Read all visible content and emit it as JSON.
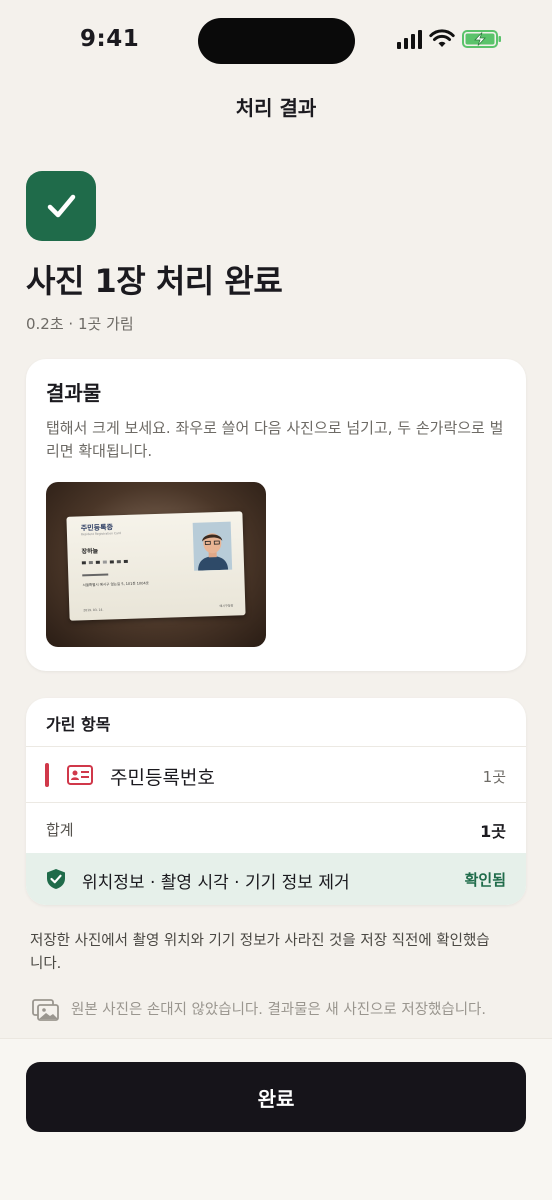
{
  "status_bar": {
    "time": "9:41"
  },
  "nav": {
    "title": "처리 결과"
  },
  "hero": {
    "headline": "사진 1장 처리 완료",
    "subline": "0.2초 · 1곳 가림"
  },
  "result_card": {
    "title": "결과물",
    "description": "탭해서 크게 보세요. 좌우로 쓸어 다음 사진으로 넘기고, 두 손가락으로 벌리면 확대됩니다.",
    "thumbnail": {
      "card_title": "주민등록증",
      "card_subtitle": "Resident Registration Card",
      "holder_name": "장하늘",
      "address": "서울특별시 예시구 없는길 5, 101동 1004호",
      "issue_date": "2019. 03. 14.",
      "issuer": "예시구청장"
    }
  },
  "masked_card": {
    "header": "가린 항목",
    "items": [
      {
        "label": "주민등록번호",
        "count": "1곳",
        "icon": "id-card-icon"
      }
    ],
    "total_label": "합계",
    "total_count": "1곳",
    "metadata_label": "위치정보 · 촬영 시각 · 기기 정보 제거",
    "metadata_status": "확인됨"
  },
  "note": "저장한 사진에서 촬영 위치와 기기 정보가 사라진 것을 저장 직전에 확인했습니다.",
  "original_note": "원본 사진은 손대지 않았습니다. 결과물은 새 사진으로 저장했습니다.",
  "primary_button": {
    "label": "완료"
  },
  "colors": {
    "accent_green": "#1f6b4a",
    "masked_red": "#d0384a",
    "background": "#f4f1ec",
    "button_dark": "#16141a"
  }
}
